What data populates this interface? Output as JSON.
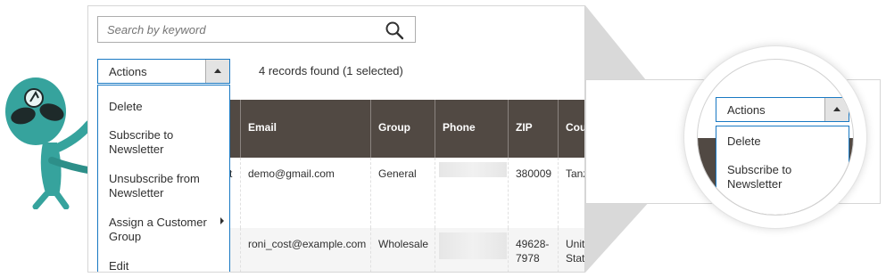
{
  "search": {
    "placeholder": "Search by keyword"
  },
  "toolbar": {
    "actions_label": "Actions",
    "records_text": "4 records found (1 selected)"
  },
  "actions_menu": {
    "items": [
      {
        "label": "Delete"
      },
      {
        "label": "Subscribe to Newsletter"
      },
      {
        "label": "Unsubscribe from Newsletter"
      },
      {
        "label": "Assign a Customer Group",
        "has_submenu": true
      },
      {
        "label": "Edit"
      }
    ]
  },
  "grid": {
    "columns": [
      "Email",
      "Group",
      "Phone",
      "ZIP",
      "Cou"
    ],
    "rows": [
      {
        "name_tail": "t",
        "email": "demo@gmail.com",
        "group": "General",
        "phone": "",
        "zip": "380009",
        "country": "Tanz"
      },
      {
        "name_tail": "",
        "email": "roni_cost@example.com",
        "group": "Wholesale",
        "phone": "",
        "zip": "49628-\n7978",
        "country": "Unit\nStat"
      }
    ]
  },
  "zoom": {
    "actions_label": "Actions",
    "items": [
      {
        "label": "Delete"
      },
      {
        "label": "Subscribe to Newsletter"
      }
    ]
  },
  "colors": {
    "header_bg": "#514943",
    "accent_border": "#1979c3",
    "mascot": "#3aa6a0"
  }
}
